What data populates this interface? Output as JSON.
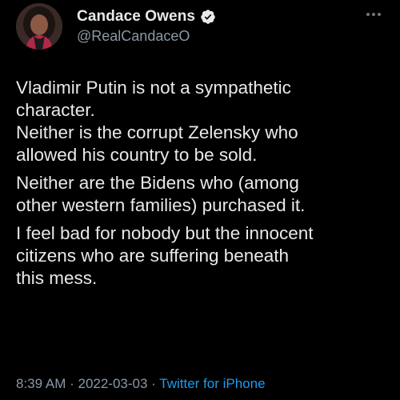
{
  "tweet": {
    "author": {
      "display_name": "Candace Owens",
      "handle": "@RealCandaceO",
      "verified": true,
      "verified_color": "#1d9bf0"
    },
    "more_icon": "more-horizontal-icon",
    "paragraphs": [
      "Vladimir Putin is not a sympathetic\ncharacter.",
      "Neither is the corrupt Zelensky who\nallowed his country to be sold.",
      "Neither are the Bidens who (among\nother western families) purchased it.",
      "I feel bad for nobody but the innocent\ncitizens who are suffering beneath\nthis mess."
    ],
    "meta": {
      "time": "8:39 AM",
      "separator1": " · ",
      "date": "2022-03-03",
      "separator2": " · ",
      "source": "Twitter for iPhone"
    }
  },
  "colors": {
    "background": "#000000",
    "text": "#e7e9ea",
    "secondary": "#8b98a5",
    "link": "#1d9bf0"
  }
}
